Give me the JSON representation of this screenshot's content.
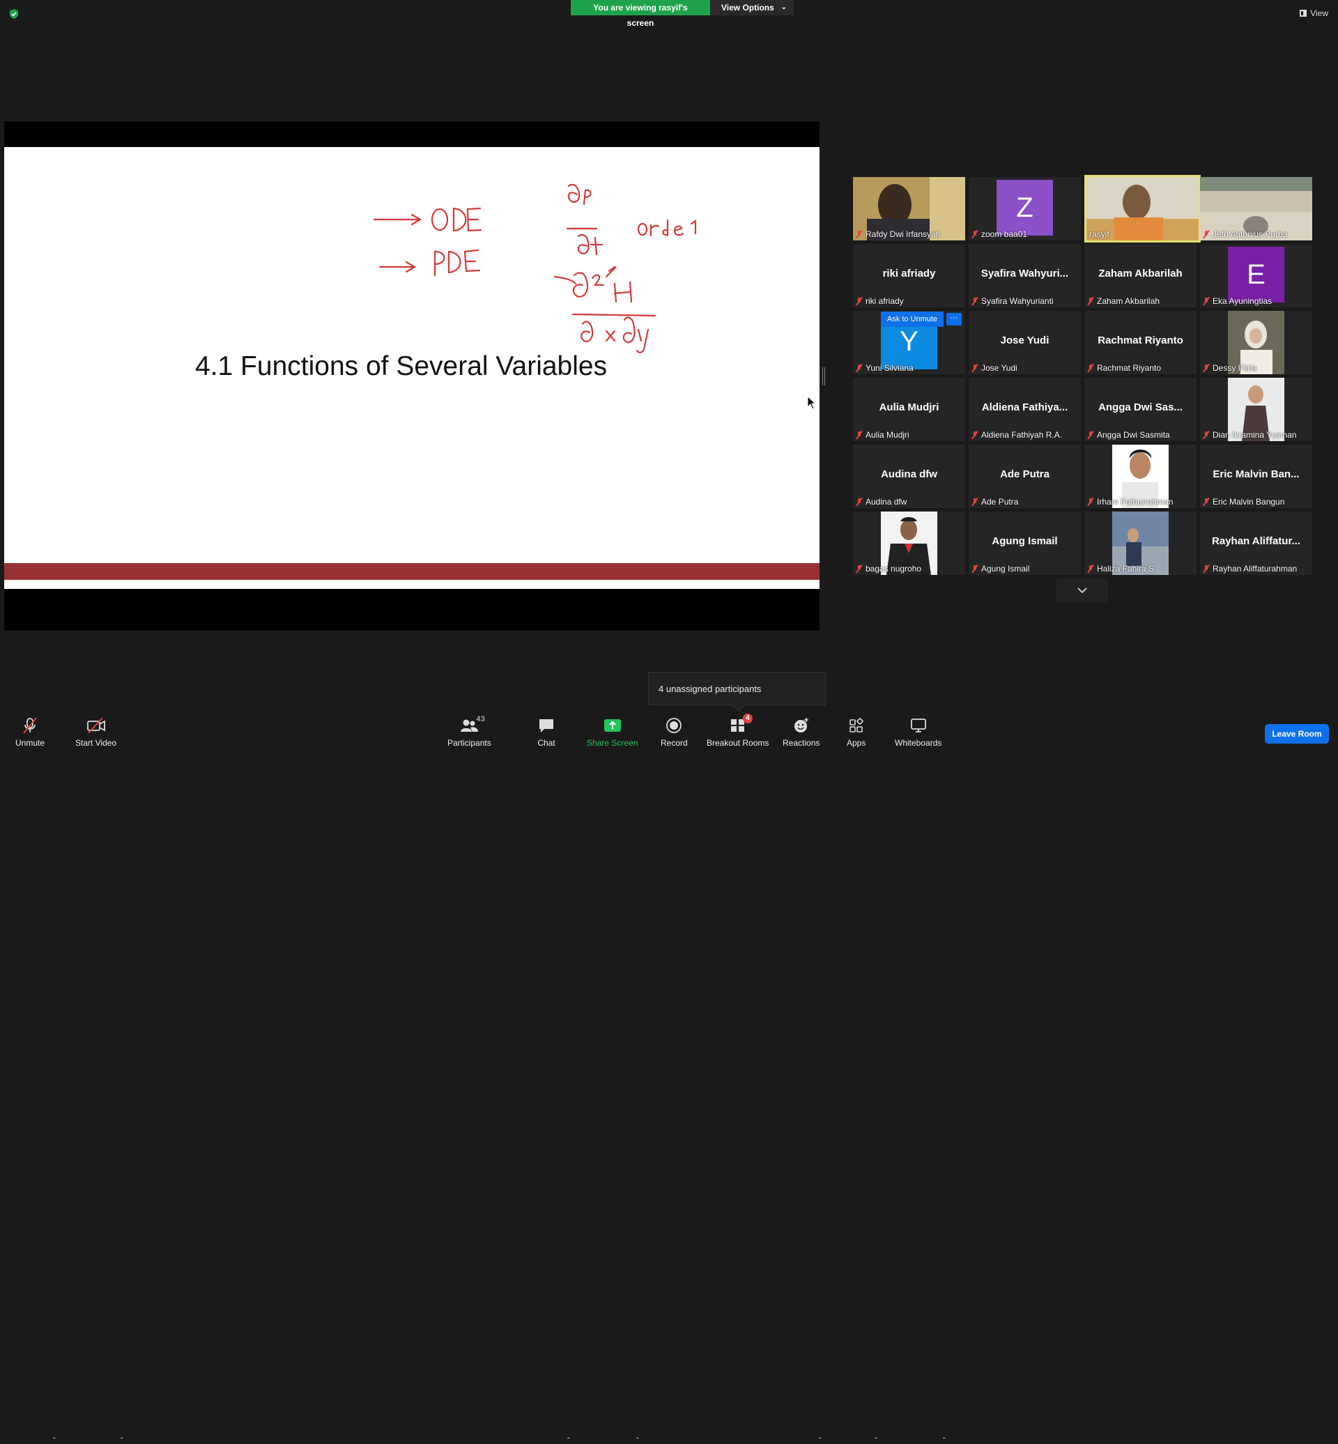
{
  "top": {
    "viewing_text": "You are viewing rasyif's screen",
    "view_options": "View Options",
    "view": "View"
  },
  "slide": {
    "title": "4.1 Functions of Several Variables"
  },
  "gallery": {
    "tiles": [
      {
        "caption": "Rafdy Dwi Irfansyah",
        "big": ""
      },
      {
        "caption": "zoom baa01",
        "big": "",
        "letter": "Z"
      },
      {
        "caption": "rasyif",
        "big": ""
      },
      {
        "caption": "Jefri Antonius Purba",
        "big": ""
      },
      {
        "caption": "riki afriady",
        "big": "riki afriady"
      },
      {
        "caption": "Syafira Wahyurianti",
        "big": "Syafira  Wahyuri..."
      },
      {
        "caption": "Zaham Akbarilah",
        "big": "Zaham Akbarilah"
      },
      {
        "caption": "Eka Ayuningtias",
        "big": "",
        "letter": "E"
      },
      {
        "caption": "Yuni Silviana",
        "big": "",
        "letter": "Y"
      },
      {
        "caption": "Jose Yudi",
        "big": "Jose Yudi"
      },
      {
        "caption": "Rachmat Riyanto",
        "big": "Rachmat Riyanto"
      },
      {
        "caption": "Dessy Fitria",
        "big": ""
      },
      {
        "caption": "Aulia Mudjri",
        "big": "Aulia Mudjri"
      },
      {
        "caption": "Aldiena Fathiyah R.A.",
        "big": "Aldiena  Fathiya..."
      },
      {
        "caption": "Angga Dwi Sasmita",
        "big": "Angga Dwi Sas..."
      },
      {
        "caption": "Dian Ikramina Yusman",
        "big": ""
      },
      {
        "caption": "Audina dfw",
        "big": "Audina dfw"
      },
      {
        "caption": "Ade Putra",
        "big": "Ade Putra"
      },
      {
        "caption": "Irham Fathurrahman",
        "big": ""
      },
      {
        "caption": "Eric Malvin Bangun",
        "big": "Eric  Malvin  Ban..."
      },
      {
        "caption": "bagas nugroho",
        "big": ""
      },
      {
        "caption": "Agung Ismail",
        "big": "Agung Ismail"
      },
      {
        "caption": "Haliza Fahira S",
        "big": ""
      },
      {
        "caption": "Rayhan Aliffaturahman",
        "big": "Rayhan  Aliffatur..."
      }
    ],
    "ask_to_unmute": "Ask to Unmute",
    "more": "···"
  },
  "tooltip": {
    "unassigned": "4 unassigned participants"
  },
  "toolbar": {
    "unmute": "Unmute",
    "start_video": "Start Video",
    "participants": "Participants",
    "participants_count": "43",
    "chat": "Chat",
    "share_screen": "Share Screen",
    "record": "Record",
    "breakout_rooms": "Breakout Rooms",
    "breakout_badge": "4",
    "reactions": "Reactions",
    "apps": "Apps",
    "whiteboards": "Whiteboards",
    "leave_room": "Leave Room"
  },
  "colors": {
    "accent_green": "#1fa34a",
    "accent_blue": "#0e71eb",
    "active_border": "#e6e070",
    "slide_band": "#983234",
    "mute_red": "#e0453d"
  }
}
